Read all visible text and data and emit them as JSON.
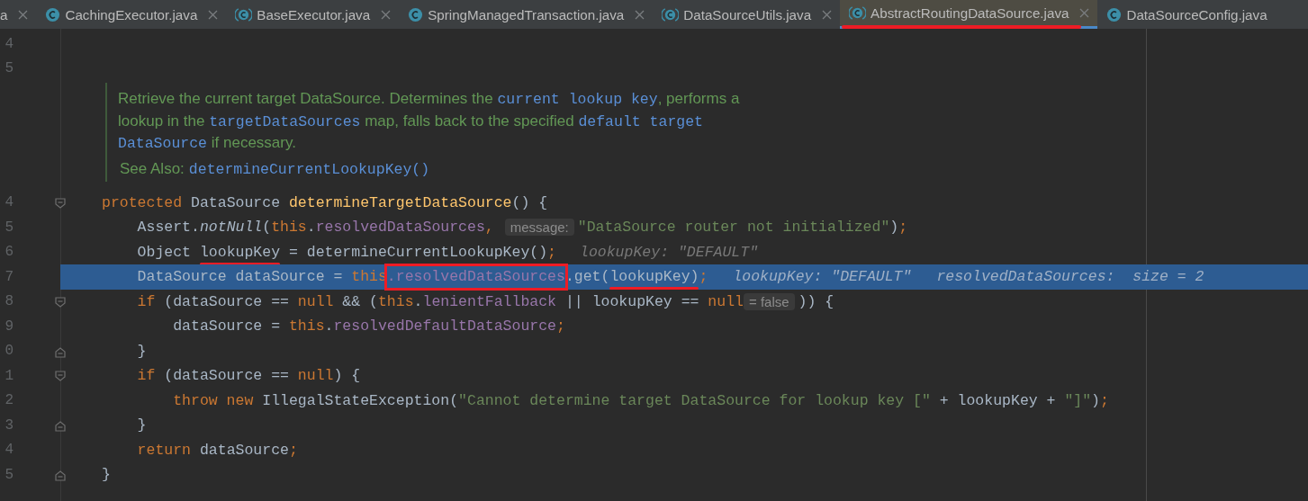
{
  "tabs": [
    {
      "label": "a",
      "selected": false,
      "closable": true
    },
    {
      "label": "CachingExecutor.java",
      "kind": "class",
      "selected": false,
      "closable": true
    },
    {
      "label": "BaseExecutor.java",
      "kind": "abstract",
      "selected": false,
      "closable": true
    },
    {
      "label": "SpringManagedTransaction.java",
      "kind": "class",
      "selected": false,
      "closable": true
    },
    {
      "label": "DataSourceUtils.java",
      "kind": "abstract",
      "selected": false,
      "closable": true
    },
    {
      "label": "AbstractRoutingDataSource.java",
      "kind": "abstract",
      "selected": true,
      "closable": true,
      "annotated": true
    },
    {
      "label": "DataSourceConfig.java",
      "kind": "class",
      "selected": false,
      "closable": false
    }
  ],
  "editor": {
    "blocks": [
      {
        "kind": "line",
        "number": "4",
        "selected": false
      },
      {
        "kind": "line",
        "number": "5",
        "selected": false
      },
      {
        "kind": "doc",
        "lines": [
          [
            {
              "kind": "text",
              "text": "Retrieve the current target DataSource. Determines the "
            },
            {
              "kind": "code",
              "text": "current lookup key"
            },
            {
              "kind": "text",
              "text": ", performs a"
            }
          ],
          [
            {
              "kind": "text",
              "text": "lookup in the "
            },
            {
              "kind": "code",
              "text": "targetDataSources"
            },
            {
              "kind": "text",
              "text": " map, falls back to the specified "
            },
            {
              "kind": "code",
              "text": "default target"
            }
          ],
          [
            {
              "kind": "code",
              "text": "DataSource"
            },
            {
              "kind": "text",
              "text": " if necessary."
            }
          ]
        ],
        "see_also_label": "See Also:",
        "see_also_link": "determineCurrentLookupKey()"
      },
      {
        "kind": "line",
        "number": "4",
        "selected": false,
        "fold_start": true,
        "segments": [
          {
            "kind": "code",
            "tokens": [
              {
                "kind": "keyword",
                "t": "protected "
              },
              {
                "kind": "plain",
                "t": "DataSource "
              },
              {
                "kind": "declaration",
                "t": "determineTargetDataSource"
              },
              {
                "kind": "plain",
                "t": "() {"
              }
            ]
          }
        ]
      },
      {
        "kind": "line",
        "number": "5",
        "selected": false,
        "segments": [
          {
            "kind": "code",
            "tokens": [
              {
                "kind": "plain",
                "t": "    Assert."
              },
              {
                "kind": "static_call",
                "t": "notNull"
              },
              {
                "kind": "plain",
                "t": "("
              },
              {
                "kind": "keyword",
                "t": "this"
              },
              {
                "kind": "plain",
                "t": "."
              },
              {
                "kind": "field",
                "t": "resolvedDataSources"
              },
              {
                "kind": "keyword",
                "t": ","
              }
            ]
          },
          {
            "kind": "hint",
            "text": "message:"
          },
          {
            "kind": "code",
            "tokens": [
              {
                "kind": "string",
                "t": "\"DataSource router not initialized\""
              },
              {
                "kind": "plain",
                "t": ")"
              },
              {
                "kind": "keyword",
                "t": ";"
              }
            ]
          }
        ]
      },
      {
        "kind": "line",
        "number": "6",
        "selected": false,
        "segments": [
          {
            "kind": "code",
            "tokens": [
              {
                "kind": "plain",
                "t": "    Object "
              },
              {
                "kind": "plain",
                "t": "lookupKey",
                "underlined": true
              },
              {
                "kind": "plain",
                "t": " = determineCurrentLookupKey()"
              },
              {
                "kind": "keyword",
                "t": ";"
              }
            ]
          },
          {
            "kind": "debug",
            "text": "lookupKey: \"DEFAULT\""
          }
        ]
      },
      {
        "kind": "line",
        "number": "7",
        "selected": true,
        "segments": [
          {
            "kind": "code",
            "tokens": [
              {
                "kind": "plain",
                "t": "    DataSource dataSource = "
              },
              {
                "kind": "keyword",
                "t": "this"
              },
              {
                "kind": "field",
                "t": ".resolvedDataSources",
                "boxed": true
              },
              {
                "kind": "plain",
                "t": ".get("
              },
              {
                "kind": "plain",
                "t": "lookupKey)",
                "underlined": true
              },
              {
                "kind": "keyword",
                "t": ";"
              }
            ]
          },
          {
            "kind": "debug",
            "text": "lookupKey: \"DEFAULT\""
          },
          {
            "kind": "debug",
            "text": "resolvedDataSources:  size = 2"
          }
        ]
      },
      {
        "kind": "line",
        "number": "8",
        "selected": false,
        "fold_start": true,
        "segments": [
          {
            "kind": "code",
            "tokens": [
              {
                "kind": "keyword",
                "t": "    if "
              },
              {
                "kind": "plain",
                "t": "(dataSource == "
              },
              {
                "kind": "keyword",
                "t": "null "
              },
              {
                "kind": "plain",
                "t": "&& ("
              },
              {
                "kind": "keyword",
                "t": "this"
              },
              {
                "kind": "plain",
                "t": "."
              },
              {
                "kind": "field",
                "t": "lenientFallback "
              },
              {
                "kind": "plain",
                "t": "|| lookupKey == "
              },
              {
                "kind": "keyword",
                "t": "null"
              }
            ]
          },
          {
            "kind": "hint",
            "text": "= false"
          },
          {
            "kind": "code",
            "tokens": [
              {
                "kind": "plain",
                "t": ")) {"
              }
            ]
          }
        ]
      },
      {
        "kind": "line",
        "number": "9",
        "selected": false,
        "segments": [
          {
            "kind": "code",
            "tokens": [
              {
                "kind": "plain",
                "t": "        dataSource = "
              },
              {
                "kind": "keyword",
                "t": "this"
              },
              {
                "kind": "plain",
                "t": "."
              },
              {
                "kind": "field",
                "t": "resolvedDefaultDataSource"
              },
              {
                "kind": "keyword",
                "t": ";"
              }
            ]
          }
        ]
      },
      {
        "kind": "line",
        "number": "0",
        "selected": false,
        "fold_end": true,
        "segments": [
          {
            "kind": "code",
            "tokens": [
              {
                "kind": "plain",
                "t": "    }"
              }
            ]
          }
        ]
      },
      {
        "kind": "line",
        "number": "1",
        "selected": false,
        "fold_start": true,
        "segments": [
          {
            "kind": "code",
            "tokens": [
              {
                "kind": "keyword",
                "t": "    if "
              },
              {
                "kind": "plain",
                "t": "(dataSource == "
              },
              {
                "kind": "keyword",
                "t": "null"
              },
              {
                "kind": "plain",
                "t": ") {"
              }
            ]
          }
        ]
      },
      {
        "kind": "line",
        "number": "2",
        "selected": false,
        "segments": [
          {
            "kind": "code",
            "tokens": [
              {
                "kind": "keyword",
                "t": "        throw new "
              },
              {
                "kind": "plain",
                "t": "IllegalStateException("
              },
              {
                "kind": "string",
                "t": "\"Cannot determine target DataSource for lookup key [\" "
              },
              {
                "kind": "plain",
                "t": "+ lookupKey + "
              },
              {
                "kind": "string",
                "t": "\"]\""
              },
              {
                "kind": "plain",
                "t": ")"
              },
              {
                "kind": "keyword",
                "t": ";"
              }
            ]
          }
        ]
      },
      {
        "kind": "line",
        "number": "3",
        "selected": false,
        "fold_end": true,
        "segments": [
          {
            "kind": "code",
            "tokens": [
              {
                "kind": "plain",
                "t": "    }"
              }
            ]
          }
        ]
      },
      {
        "kind": "line",
        "number": "4",
        "selected": false,
        "segments": [
          {
            "kind": "code",
            "tokens": [
              {
                "kind": "keyword",
                "t": "    return "
              },
              {
                "kind": "plain",
                "t": "dataSource"
              },
              {
                "kind": "keyword",
                "t": ";"
              }
            ]
          }
        ]
      },
      {
        "kind": "line",
        "number": "5",
        "selected": false,
        "fold_end": true,
        "segments": [
          {
            "kind": "code",
            "tokens": [
              {
                "kind": "plain",
                "t": "}"
              }
            ]
          }
        ]
      }
    ]
  }
}
